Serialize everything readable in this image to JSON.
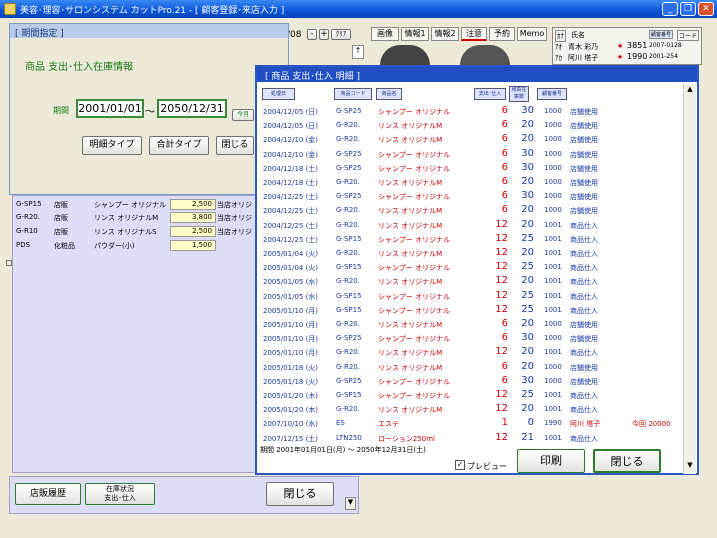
{
  "window": {
    "title": "美容･理容･サロンシステム カットPro.21 - [ 顧客登録･来店入力 ]",
    "min": "_",
    "restore": "❐",
    "close": "✕"
  },
  "background": {
    "date_partial": "/08",
    "nav_prev": "-",
    "nav_next": "+",
    "clear": "ｸﾘｱ",
    "tabs": [
      "画像",
      "情報1",
      "情報2",
      "注意",
      "予約",
      "Memo"
    ],
    "right_header": {
      "kana": "ｶﾅ",
      "name_label": "氏名",
      "cust_no": "顧客番号",
      "code": "コード"
    },
    "customers": [
      {
        "kana": "ｱｵ",
        "name": "青木 彩乃",
        "star": "★",
        "no": "3851",
        "code": "2007-0128"
      },
      {
        "kana": "ｱｶ",
        "name": "阿川 塔子",
        "star": "★",
        "no": "1990",
        "code": "2001-254"
      }
    ]
  },
  "period_dialog": {
    "title": "[ 期間指定 ]",
    "heading": "商品 支出･仕入在庫情報",
    "period_label": "期間",
    "date_from": "2001/01/01",
    "tilde": "～",
    "date_to": "2050/12/31",
    "this_month": "今月",
    "detail_btn": "明細タイプ",
    "total_btn": "合計タイプ",
    "close_btn": "閉じる"
  },
  "lower_list": [
    {
      "code": "G-SP15",
      "cat": "店販",
      "name": "シャンプー オリジナル",
      "price": "2,500",
      "note": "当店オリジ"
    },
    {
      "code": "G-R20.",
      "cat": "店販",
      "name": "リンス オリジナルM",
      "price": "3,800",
      "note": "当店オリジ"
    },
    {
      "code": "G-R10",
      "cat": "店販",
      "name": "リンス オリジナルS",
      "price": "2,500",
      "note": "当店オリジ"
    },
    {
      "code": "PDS",
      "cat": "化粧品",
      "name": "パウダー(小)",
      "price": "1,500",
      "note": ""
    }
  ],
  "footer": {
    "history_btn": "店販履歴",
    "stock_btn_1": "在庫状況",
    "stock_btn_2": "支出･仕入",
    "close_btn": "閉じる"
  },
  "detail": {
    "title": "[ 商品 支出･仕入 明細 ]",
    "headers": {
      "date": "処理日",
      "code": "商品コード",
      "name": "商品名",
      "out_in": "支出･仕入",
      "stock": "残高在庫数",
      "cust_no": "顧客番号"
    },
    "rows": [
      {
        "date": "2004/12/05 (日)",
        "code": "G-SP25",
        "name": "シャンプー オリジナル",
        "qty": "6",
        "stock": "30",
        "cust": "1000",
        "note": "店舗使用"
      },
      {
        "date": "2004/12/05 (日)",
        "code": "G-R20.",
        "name": "リンス オリジナルM",
        "qty": "6",
        "stock": "20",
        "cust": "1000",
        "note": "店舗使用"
      },
      {
        "date": "2004/12/10 (金)",
        "code": "G-R20.",
        "name": "リンス オリジナルM",
        "qty": "6",
        "stock": "20",
        "cust": "1000",
        "note": "店舗使用"
      },
      {
        "date": "2004/12/10 (金)",
        "code": "G-SP25",
        "name": "シャンプー オリジナル",
        "qty": "6",
        "stock": "30",
        "cust": "1000",
        "note": "店舗使用"
      },
      {
        "date": "2004/12/18 (土)",
        "code": "G-SP25",
        "name": "シャンプー オリジナル",
        "qty": "6",
        "stock": "30",
        "cust": "1000",
        "note": "店舗使用"
      },
      {
        "date": "2004/12/18 (土)",
        "code": "G-R20.",
        "name": "リンス オリジナルM",
        "qty": "6",
        "stock": "20",
        "cust": "1000",
        "note": "店舗使用"
      },
      {
        "date": "2004/12/25 (土)",
        "code": "G-SP25",
        "name": "シャンプー オリジナル",
        "qty": "6",
        "stock": "30",
        "cust": "1000",
        "note": "店舗使用"
      },
      {
        "date": "2004/12/25 (土)",
        "code": "G-R20.",
        "name": "リンス オリジナルM",
        "qty": "6",
        "stock": "20",
        "cust": "1000",
        "note": "店舗使用"
      },
      {
        "date": "2004/12/25 (土)",
        "code": "G-R20.",
        "name": "リンス オリジナルM",
        "qty": "12",
        "stock": "20",
        "cust": "1001",
        "note": "商品仕入"
      },
      {
        "date": "2004/12/25 (土)",
        "code": "G-SP15",
        "name": "シャンプー オリジナル",
        "qty": "12",
        "stock": "25",
        "cust": "1001",
        "note": "商品仕入"
      },
      {
        "date": "2005/01/04 (火)",
        "code": "G-R20.",
        "name": "リンス オリジナルM",
        "qty": "12",
        "stock": "20",
        "cust": "1001",
        "note": "商品仕入"
      },
      {
        "date": "2005/01/04 (火)",
        "code": "G-SP15",
        "name": "シャンプー オリジナル",
        "qty": "12",
        "stock": "25",
        "cust": "1001",
        "note": "商品仕入"
      },
      {
        "date": "2005/01/05 (水)",
        "code": "G-R20.",
        "name": "リンス オリジナルM",
        "qty": "12",
        "stock": "20",
        "cust": "1001",
        "note": "商品仕入"
      },
      {
        "date": "2005/01/05 (水)",
        "code": "G-SP15",
        "name": "シャンプー オリジナル",
        "qty": "12",
        "stock": "25",
        "cust": "1001",
        "note": "商品仕入"
      },
      {
        "date": "2005/01/10 (月)",
        "code": "G-SP15",
        "name": "シャンプー オリジナル",
        "qty": "12",
        "stock": "25",
        "cust": "1001",
        "note": "商品仕入"
      },
      {
        "date": "2005/01/10 (月)",
        "code": "G-R20.",
        "name": "リンス オリジナルM",
        "qty": "6",
        "stock": "20",
        "cust": "1000",
        "note": "店舗使用"
      },
      {
        "date": "2005/01/10 (月)",
        "code": "G-SP25",
        "name": "シャンプー オリジナル",
        "qty": "6",
        "stock": "30",
        "cust": "1000",
        "note": "店舗使用"
      },
      {
        "date": "2005/01/10 (月)",
        "code": "G-R20.",
        "name": "リンス オリジナルM",
        "qty": "12",
        "stock": "20",
        "cust": "1001",
        "note": "商品仕入"
      },
      {
        "date": "2005/01/18 (火)",
        "code": "G-R20.",
        "name": "リンス オリジナルM",
        "qty": "6",
        "stock": "20",
        "cust": "1000",
        "note": "店舗使用"
      },
      {
        "date": "2005/01/18 (火)",
        "code": "G-SP25",
        "name": "シャンプー オリジナル",
        "qty": "6",
        "stock": "30",
        "cust": "1000",
        "note": "店舗使用"
      },
      {
        "date": "2005/01/20 (木)",
        "code": "G-SP15",
        "name": "シャンプー オリジナル",
        "qty": "12",
        "stock": "25",
        "cust": "1001",
        "note": "商品仕入"
      },
      {
        "date": "2005/01/20 (木)",
        "code": "G-R20.",
        "name": "リンス オリジナルM",
        "qty": "12",
        "stock": "20",
        "cust": "1001",
        "note": "商品仕入"
      },
      {
        "date": "2007/10/10 (水)",
        "code": "ES",
        "name": "エステ",
        "qty": "1",
        "stock": "0",
        "cust": "1990",
        "note": "阿川 塔子",
        "extra": "今回 20000"
      },
      {
        "date": "2007/12/15 (土)",
        "code": "LTN250",
        "name": "ローション250ml",
        "qty": "12",
        "stock": "21",
        "cust": "1001",
        "note": "商品仕入"
      }
    ],
    "period_footer": "期間 2001年01月01日(月) ～ 2050年12月31日(土)",
    "preview_label": "プレビュー",
    "print_btn": "印刷",
    "close_btn": "閉じる"
  }
}
